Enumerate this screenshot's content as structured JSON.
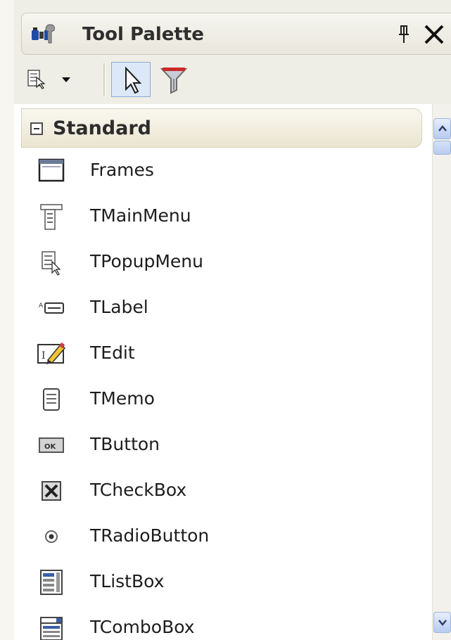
{
  "palette": {
    "title": "Tool Palette",
    "pin_glyph": "ᵖ",
    "pin_label": "pin-icon",
    "close_icon": "close-icon",
    "title_icon": "tool-palette-icon"
  },
  "toolbar": {
    "items": [
      {
        "name": "popup-menu-dropdown",
        "icon": "popup-menu-icon"
      },
      {
        "name": "pointer",
        "icon": "pointer-arrow-icon",
        "selected": true
      },
      {
        "name": "filter",
        "icon": "filter-funnel-icon"
      }
    ]
  },
  "category": {
    "label": "Standard",
    "expanded": true
  },
  "items": [
    {
      "label": "Frames",
      "icon": "frames-icon"
    },
    {
      "label": "TMainMenu",
      "icon": "main-menu-icon"
    },
    {
      "label": "TPopupMenu",
      "icon": "popup-menu-icon"
    },
    {
      "label": "TLabel",
      "icon": "label-icon"
    },
    {
      "label": "TEdit",
      "icon": "edit-icon"
    },
    {
      "label": "TMemo",
      "icon": "memo-icon"
    },
    {
      "label": "TButton",
      "icon": "button-icon"
    },
    {
      "label": "TCheckBox",
      "icon": "checkbox-icon"
    },
    {
      "label": "TRadioButton",
      "icon": "radio-button-icon"
    },
    {
      "label": "TListBox",
      "icon": "listbox-icon"
    },
    {
      "label": "TComboBox",
      "icon": "combobox-icon"
    }
  ],
  "colors": {
    "accent": "#8fa9d6",
    "header_bg": "#ebe5d0",
    "panel_bg": "#ffffff"
  }
}
